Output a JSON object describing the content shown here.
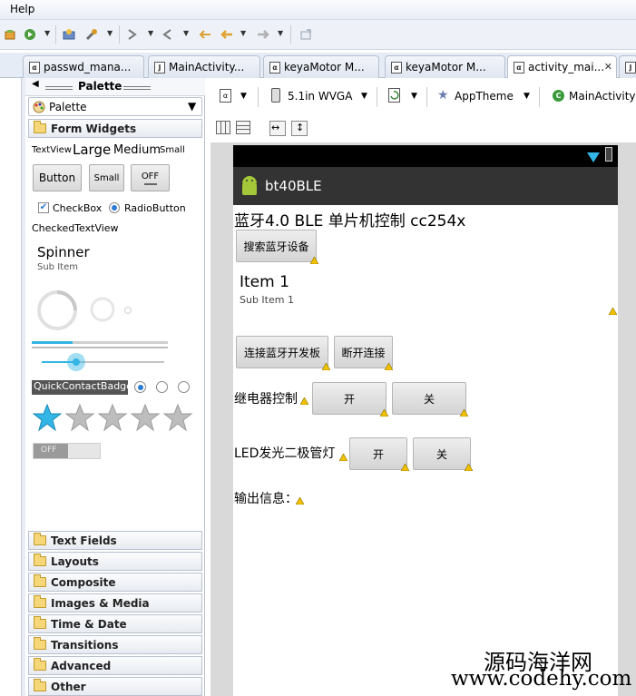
{
  "menubar": {
    "help": "Help"
  },
  "tabs": [
    {
      "label": "passwd_mana..."
    },
    {
      "label": "MainActivity..."
    },
    {
      "label": "keyaMotor M..."
    },
    {
      "label": "keyaMotor M..."
    },
    {
      "label": "activity_mai..."
    }
  ],
  "palette": {
    "header": "Palette",
    "dropdown": "Palette",
    "form_widgets": "Form Widgets",
    "textview": "TextView",
    "large": "Large",
    "medium": "Medium",
    "small": "Small",
    "button": "Button",
    "small_button": "Small",
    "toggle_off": "OFF",
    "checkbox": "CheckBox",
    "radiobutton": "RadioButton",
    "checked_textview": "CheckedTextView",
    "spinner": "Spinner",
    "sub_item": "Sub Item",
    "quick_contact": "QuickContactBadge",
    "switch_off": "OFF",
    "categories": [
      "Text Fields",
      "Layouts",
      "Composite",
      "Images & Media",
      "Time & Date",
      "Transitions",
      "Advanced",
      "Other"
    ]
  },
  "editor_toolbar": {
    "device": "5.1in WVGA",
    "theme": "AppTheme",
    "activity": "MainActivity"
  },
  "device": {
    "app_title": "bt40BLE",
    "heading": "蓝牙4.0 BLE 单片机控制  cc254x",
    "search_button": "搜索蓝牙设备",
    "list_item": "Item 1",
    "list_sub": "Sub Item 1",
    "connect_button": "连接蓝牙开发板",
    "disconnect_button": "断开连接",
    "relay_label": "继电器控制",
    "relay_on": "开",
    "relay_off": "关",
    "led_label": "LED发光二极管灯",
    "led_on": "开",
    "led_off": "关",
    "output_label": "输出信息："
  },
  "watermark": {
    "line1": "源码海洋网",
    "line2": "www.codehy.com"
  },
  "colors": {
    "accent_blue": "#33b5e5",
    "app_bar": "#333333",
    "status_bar": "#000000"
  }
}
